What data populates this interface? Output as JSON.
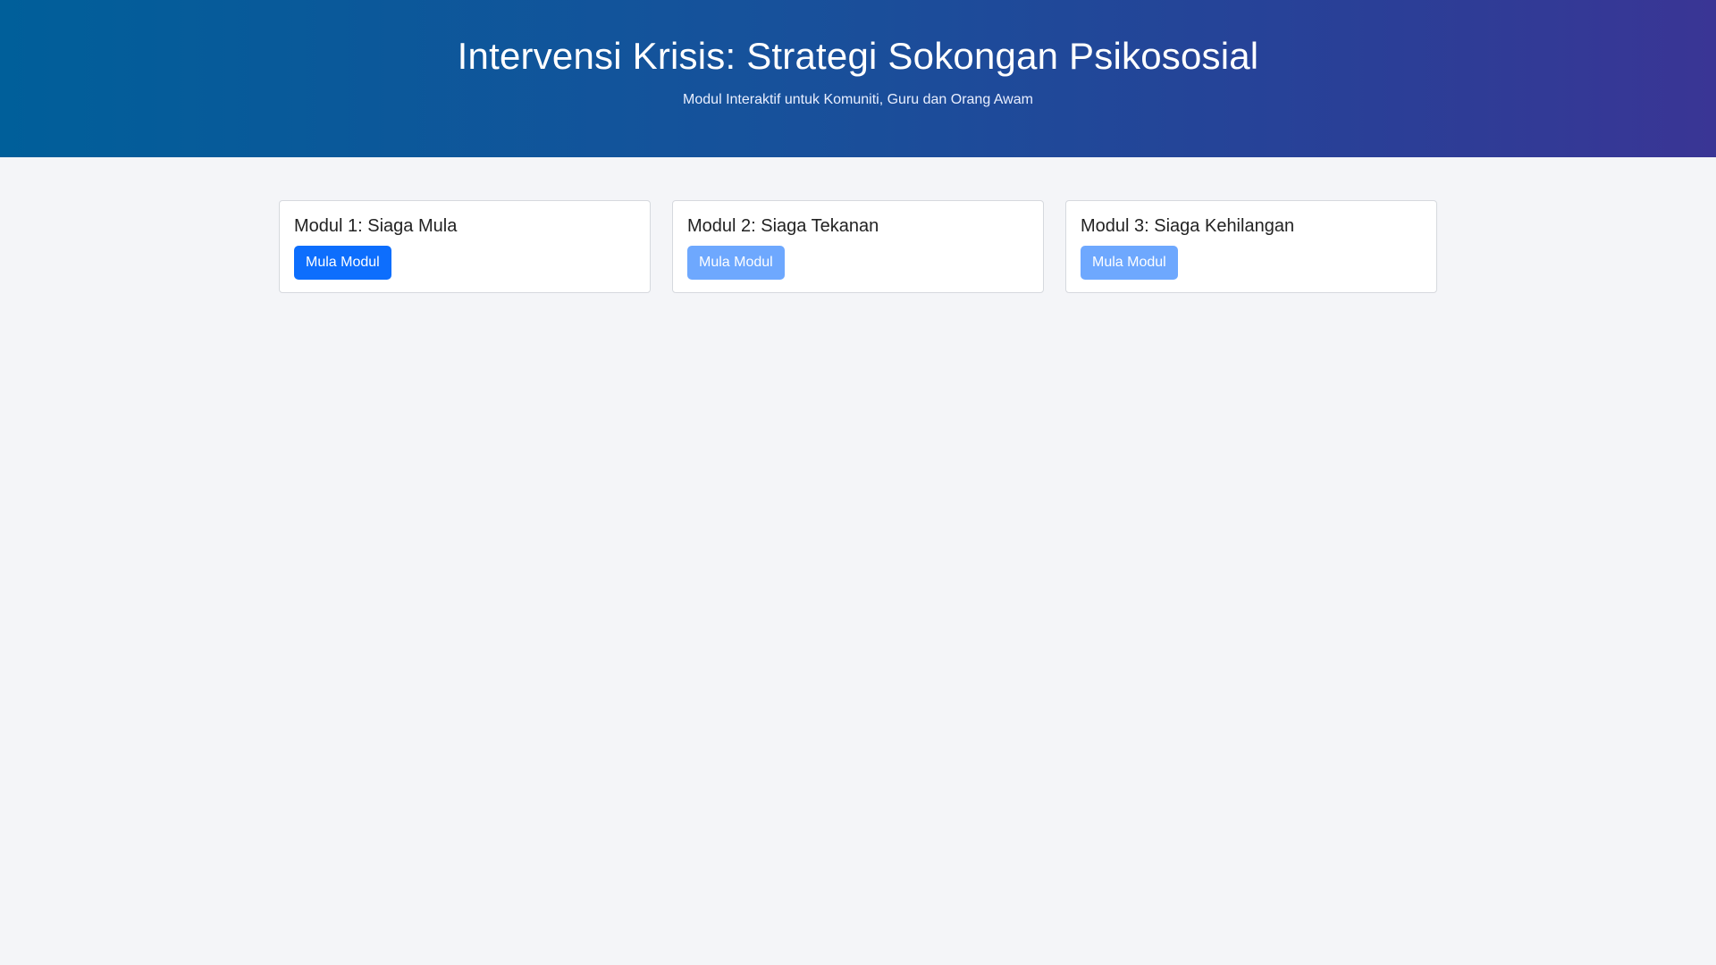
{
  "header": {
    "title": "Intervensi Krisis: Strategi Sokongan Psikososial",
    "subtitle": "Modul Interaktif untuk Komuniti, Guru dan Orang Awam"
  },
  "modules": [
    {
      "title": "Modul 1: Siaga Mula",
      "button_label": "Mula Modul",
      "button_state": "active",
      "button_color": "#0d6efd"
    },
    {
      "title": "Modul 2: Siaga Tekanan",
      "button_label": "Mula Modul",
      "button_state": "disabled",
      "button_color": "#6ea8fe"
    },
    {
      "title": "Modul 3: Siaga Kehilangan",
      "button_label": "Mula Modul",
      "button_state": "disabled",
      "button_color": "#6ea8fe"
    }
  ],
  "colors": {
    "header_gradient_start": "#005f9a",
    "header_gradient_end": "#3a3595",
    "page_background": "#f4f5f8"
  }
}
